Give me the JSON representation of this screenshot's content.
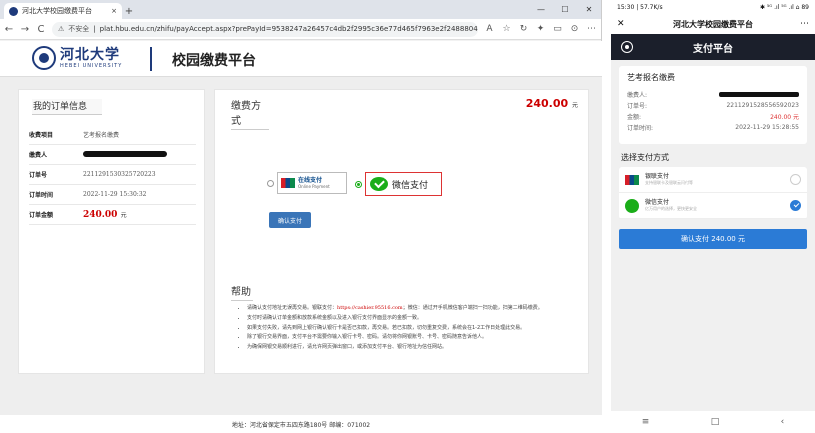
{
  "browser": {
    "tab_title": "河北大学校园缴费平台",
    "tab_close": "×",
    "new_tab": "+",
    "win_min": "—",
    "win_max": "☐",
    "win_close": "✕",
    "back": "←",
    "forward": "→",
    "reload": "C",
    "insecure": "不安全",
    "url": "plat.hbu.edu.cn/zhifu/payAccept.aspx?prePayId=9538247a26457c4db2f2995c36e77d465f7963e2f24888044be10...",
    "toolbar_icons": [
      "A",
      "☆",
      "↻",
      "✦",
      "▭",
      "⊙",
      "⋯"
    ]
  },
  "site": {
    "logo_cn": "河北大学",
    "logo_en": "HEBEI UNIVERSITY",
    "title": "校园缴费平台",
    "order_heading": "我的订单信息",
    "order": [
      {
        "k": "收费项目",
        "v": "艺考报名缴费"
      },
      {
        "k": "缴费人",
        "v": ""
      },
      {
        "k": "订单号",
        "v": "2211291530325720223"
      },
      {
        "k": "订单时间",
        "v": "2022-11-29 15:30:32"
      },
      {
        "k": "订单金额",
        "v": "240.00",
        "unit": "元"
      }
    ],
    "pay_heading": "缴费方式",
    "total": "240.00",
    "total_unit": "元",
    "unionpay_name": "在线支付",
    "unionpay_sub": "Online Payment",
    "wechat_name": "微信支付",
    "confirm": "确认支付",
    "help_heading": "帮助",
    "help_items": [
      {
        "a": "请确认支付地址无误再交易。银联支付：",
        "b": "https://cashier.95516.com",
        "c": "；微信：通过开手机微信客户端扫一扫功能，扫第二维码缴费。"
      },
      {
        "a": "支付时请确认订单金额和放款系统金额以及进入银行支付界面显示的金额一致。",
        "b": "",
        "c": ""
      },
      {
        "a": "如果支付失败，请先到网上银行确认银行卡是否已扣款，再交易。若已扣款，切勿重复交费，系统会在1-2工作日处理此交易。",
        "b": "",
        "c": ""
      },
      {
        "a": "除了银行交易界面，支付平台不需要你输入银行卡号、密码。请勿将你网银账号、卡号、密码随意告诉他人。",
        "b": "",
        "c": ""
      },
      {
        "a": "为确保网银交易顺利进行，请允许网页弹出窗口，或添加支付平台、银行地址为信任网站。",
        "b": "",
        "c": ""
      }
    ],
    "footer": "地址：河北省保定市五四东路180号 邮编：071002"
  },
  "phone": {
    "status_left": "15:30 | 57.7K/s",
    "status_right": "✱ ⁵ᴳ .ıl ⁵ᴳ .ıl ⌂ 89",
    "close": "✕",
    "app_title": "河北大学校园缴费平台",
    "more": "⋯",
    "pay_title": "支付平台",
    "card_title": "艺考报名缴费",
    "rows": [
      {
        "k": "缴费人:",
        "v": ""
      },
      {
        "k": "订单号:",
        "v": "2211291528556592023"
      },
      {
        "k": "金额:",
        "v": "240.00 元"
      },
      {
        "k": "订单时间:",
        "v": "2022-11-29 15:28:55"
      }
    ],
    "select_heading": "选择支付方式",
    "methods": [
      {
        "n": "银联支付",
        "s": "支持银联卡及银联云闪付等"
      },
      {
        "n": "微信支付",
        "s": "亿万用户的选择，更快更安全"
      }
    ],
    "pay_button": "确认支付 240.00 元",
    "nav": [
      "≡",
      "□",
      "‹"
    ]
  },
  "colors": {
    "accent": "#1e3a7b",
    "price": "#cc0000",
    "wechat": "#1aad19",
    "button": "#2b7bd6"
  },
  "icons": [
    "hbu-seal-icon",
    "unionpay-icon",
    "wechat-pay-icon",
    "lock-icon",
    "star-icon",
    "checkmark-icon"
  ]
}
